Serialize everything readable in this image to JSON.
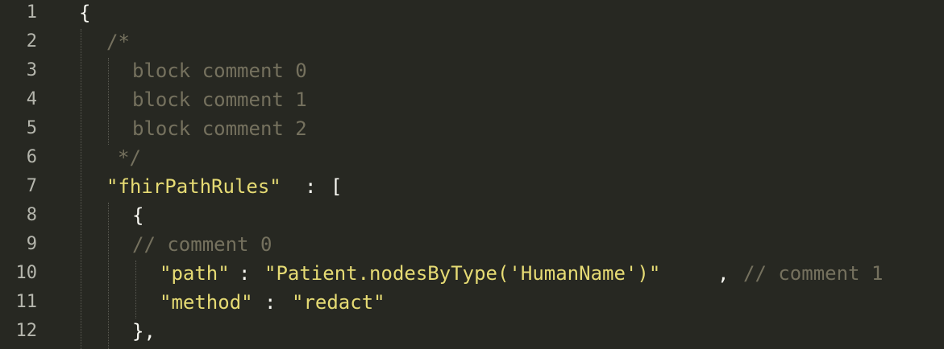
{
  "editor": {
    "line_numbers": [
      "1",
      "2",
      "3",
      "4",
      "5",
      "6",
      "7",
      "8",
      "9",
      "10",
      "11",
      "12"
    ],
    "colors": {
      "background": "#272822",
      "plain": "#f8f8f2",
      "comment": "#75715e",
      "string": "#e6db74",
      "line_number": "#b5b6ad"
    },
    "lines": {
      "l1": {
        "open_brace": "{"
      },
      "l2": {
        "comment_open": "/*"
      },
      "l3": {
        "comment_text": "block comment 0"
      },
      "l4": {
        "comment_text": "block comment 1"
      },
      "l5": {
        "comment_text": "block comment 2"
      },
      "l6": {
        "comment_close": "*/"
      },
      "l7": {
        "key": "\"fhirPathRules\"",
        "colon": ":",
        "bracket": "["
      },
      "l8": {
        "open_brace": "{"
      },
      "l9": {
        "comment": "// comment 0"
      },
      "l10": {
        "key": "\"path\"",
        "colon": ":",
        "value": "\"Patient.nodesByType('HumanName')\"",
        "comma": ",",
        "comment": "// comment 1"
      },
      "l11": {
        "key": "\"method\"",
        "colon": ":",
        "value": "\"redact\""
      },
      "l12": {
        "close": "},"
      }
    }
  }
}
